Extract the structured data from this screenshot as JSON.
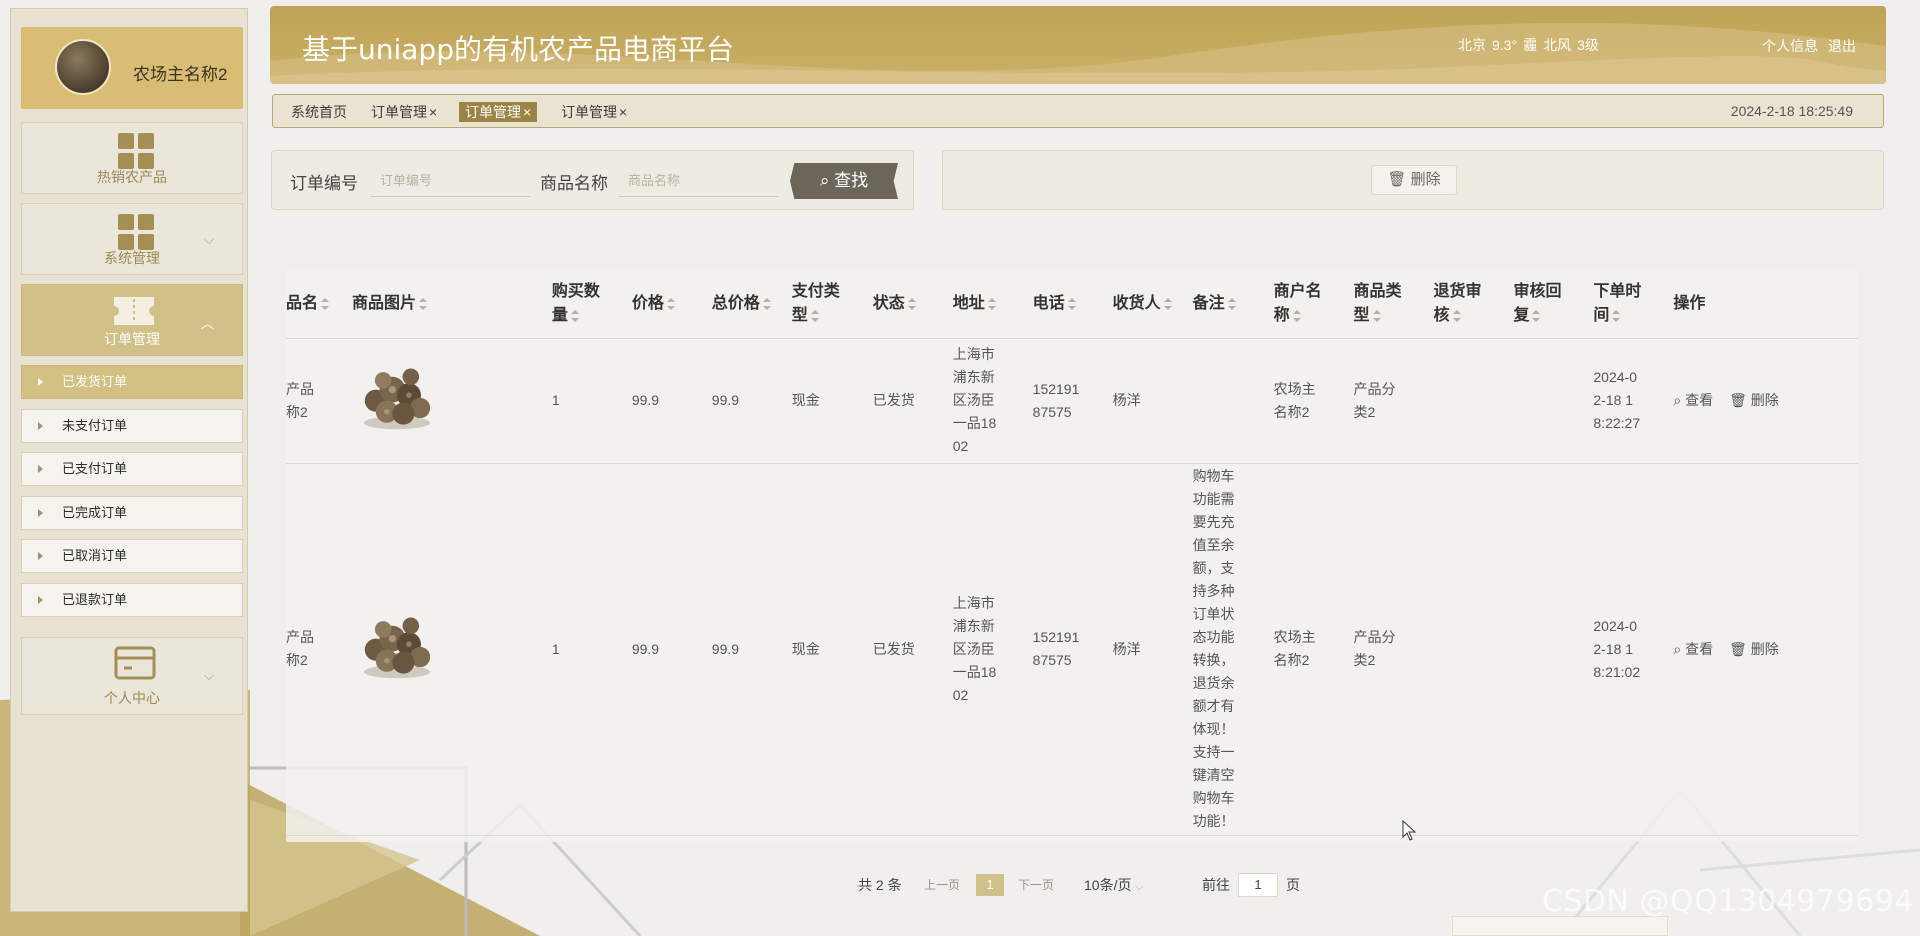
{
  "app": {
    "title": "基于uniapp的有机农产品电商平台",
    "weather": {
      "city": "北京",
      "temp": "9.3°",
      "condition": "霾",
      "wind": "北风",
      "level": "3级"
    },
    "user_links": {
      "profile": "个人信息",
      "logout": "退出"
    }
  },
  "sidebar": {
    "user_name": "农场主名称2",
    "menus": [
      {
        "label": "热销农产品",
        "icon": "grid-icon"
      },
      {
        "label": "系统管理",
        "icon": "grid-icon"
      },
      {
        "label": "订单管理",
        "icon": "ticket-icon"
      },
      {
        "label": "个人中心",
        "icon": "card-icon"
      }
    ],
    "order_sub": [
      "已发货订单",
      "未支付订单",
      "已支付订单",
      "已完成订单",
      "已取消订单",
      "已退款订单"
    ]
  },
  "tabs": {
    "items": [
      {
        "label": "系统首页",
        "closable": false
      },
      {
        "label": "订单管理",
        "closable": true
      },
      {
        "label": "订单管理",
        "closable": true,
        "active": true
      },
      {
        "label": "订单管理",
        "closable": true
      }
    ],
    "close_glyph": "×",
    "datetime": "2024-2-18 18:25:49"
  },
  "search": {
    "order_no_label": "订单编号",
    "order_no_placeholder": "订单编号",
    "product_label": "商品名称",
    "product_placeholder": "商品名称",
    "button": "查找"
  },
  "actions": {
    "delete": "删除"
  },
  "table": {
    "columns": [
      "品名",
      "商品图片",
      "购买数\n量",
      "价格",
      "总价格",
      "支付类\n型",
      "状态",
      "地址",
      "电话",
      "收货人",
      "备注",
      "商户名\n称",
      "商品类\n型",
      "退货审\n核",
      "审核回\n复",
      "下单时\n间",
      "操作"
    ],
    "rows": [
      {
        "name": "产品\n称2",
        "qty": "1",
        "price": "99.9",
        "total": "99.9",
        "pay": "现金",
        "status": "已发货",
        "address": "上海市\n浦东新\n区汤臣\n一品18\n02",
        "phone": "152191\n87575",
        "receiver": "杨洋",
        "remark": "",
        "merchant": "农场主\n名称2",
        "category": "产品分\n类2",
        "return_review": "",
        "review_reply": "",
        "time": "2024-0\n2-18 1\n8:22:27"
      },
      {
        "name": "产品\n称2",
        "qty": "1",
        "price": "99.9",
        "total": "99.9",
        "pay": "现金",
        "status": "已发货",
        "address": "上海市\n浦东新\n区汤臣\n一品18\n02",
        "phone": "152191\n87575",
        "receiver": "杨洋",
        "remark": "购物车\n功能需\n要先充\n值至余\n额，支\n持多种\n订单状\n态功能\n转换，\n退货余\n额才有\n体现！\n支持一\n键清空\n购物车\n功能！",
        "merchant": "农场主\n名称2",
        "category": "产品分\n类2",
        "return_review": "",
        "review_reply": "",
        "time": "2024-0\n2-18 1\n8:21:02"
      }
    ],
    "ops": {
      "view": "查看",
      "delete": "删除"
    }
  },
  "pager": {
    "total": "共 2 条",
    "prev": "上一页",
    "current": "1",
    "next": "下一页",
    "size": "10条/页",
    "goto_label": "前往",
    "goto_value": "1",
    "goto_unit": "页"
  },
  "watermark": "CSDN @QQ1304979694",
  "colors": {
    "accent": "#c6aa5f",
    "active_menu": "#d1c189",
    "tab_active": "#9c8447"
  }
}
